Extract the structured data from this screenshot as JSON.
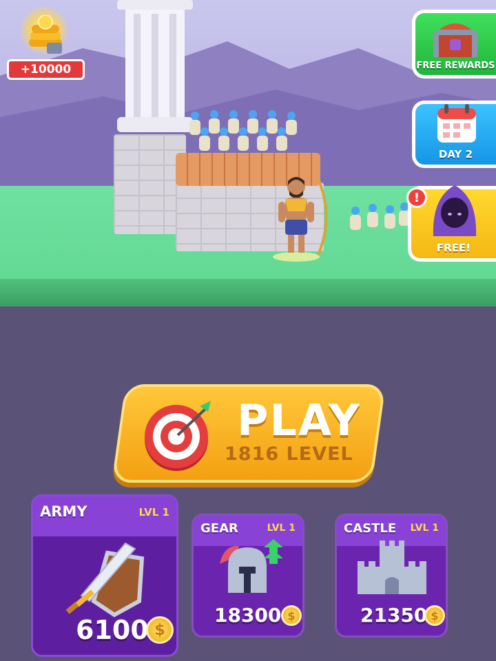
{
  "coins_bonus": {
    "label": "+10000"
  },
  "side_buttons": {
    "free_rewards": "FREE REWARDS",
    "daily": "DAY 2",
    "free": "FREE!",
    "alert": "!"
  },
  "play": {
    "title": "PLAY",
    "level": "1816 LEVEL"
  },
  "upgrades": [
    {
      "name": "ARMY",
      "level": "LVL 1",
      "price": "6100"
    },
    {
      "name": "GEAR",
      "level": "LVL 1",
      "price": "18300"
    },
    {
      "name": "CASTLE",
      "level": "LVL 1",
      "price": "21350"
    }
  ],
  "currency_symbol": "$",
  "colors": {
    "bottom_bg": "#5a5377",
    "play_button": "#f3a012",
    "card_bg": "#6a24ad",
    "rewards_green": "#22b53d",
    "day_blue": "#1595e6",
    "free_yellow": "#f5b715",
    "ribbon_red": "#e23a3a"
  }
}
